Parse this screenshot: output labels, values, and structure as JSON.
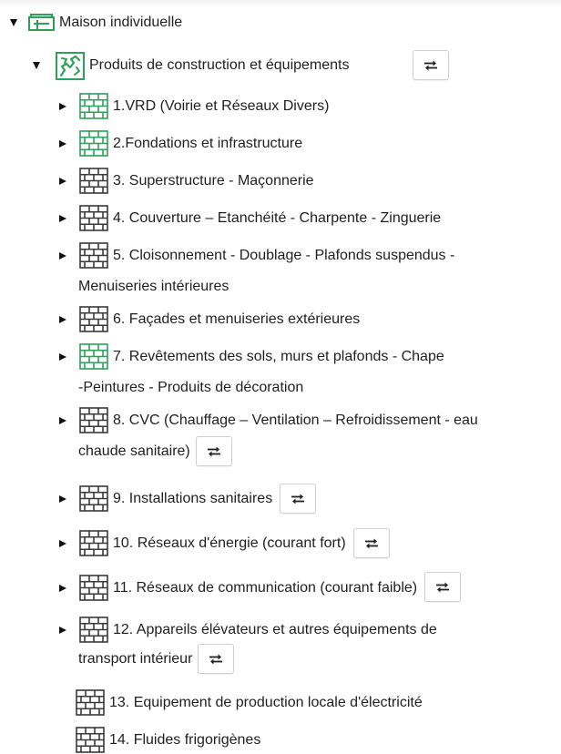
{
  "tree": {
    "root": {
      "label": "Maison individuelle",
      "icon": "building-outline-icon",
      "expanded": true
    },
    "section": {
      "label": "Produits de construction et équipements",
      "icon": "puzzle-icon",
      "expanded": true,
      "action_icon": "swap-arrows-icon"
    },
    "items": [
      {
        "label": "1.VRD (Voirie et Réseaux Divers)",
        "icon": "brick-wall-icon",
        "icon_color": "green",
        "expandable": true
      },
      {
        "label": "2.Fondations et infrastructure",
        "icon": "brick-wall-icon",
        "icon_color": "green",
        "expandable": true
      },
      {
        "label": "3. Superstructure - Maçonnerie",
        "icon": "brick-wall-icon",
        "icon_color": "gray",
        "expandable": true
      },
      {
        "label": "4. Couverture – Etanchéité - Charpente - Zinguerie",
        "icon": "brick-wall-icon",
        "icon_color": "gray",
        "expandable": true
      },
      {
        "label": "5. Cloisonnement - Doublage - Plafonds suspendus -",
        "label_cont": "Menuiseries intérieures",
        "icon": "brick-wall-icon",
        "icon_color": "gray",
        "expandable": true
      },
      {
        "label": "6. Façades et menuiseries extérieures",
        "icon": "brick-wall-icon",
        "icon_color": "gray",
        "expandable": true
      },
      {
        "label": "7. Revêtements des sols, murs et plafonds - Chape",
        "label_cont": "-Peintures - Produits de décoration",
        "icon": "brick-wall-icon",
        "icon_color": "green",
        "expandable": true
      },
      {
        "label": "8. CVC (Chauffage – Ventilation – Refroidissement - eau",
        "label_cont": "chaude sanitaire)",
        "icon": "brick-wall-icon",
        "icon_color": "gray",
        "expandable": true,
        "has_action": true
      },
      {
        "label": "9. Installations sanitaires",
        "icon": "brick-wall-icon",
        "icon_color": "gray",
        "expandable": true,
        "has_action": true
      },
      {
        "label": "10. Réseaux d'énergie (courant fort)",
        "icon": "brick-wall-icon",
        "icon_color": "gray",
        "expandable": true,
        "has_action": true
      },
      {
        "label": "11. Réseaux de communication (courant faible)",
        "icon": "brick-wall-icon",
        "icon_color": "gray",
        "expandable": true,
        "has_action": true
      },
      {
        "label": "12. Appareils élévateurs et autres équipements de",
        "label_cont": "transport intérieur",
        "icon": "brick-wall-icon",
        "icon_color": "gray",
        "expandable": true,
        "has_action": true
      },
      {
        "label": "13. Equipement de production locale d'électricité",
        "icon": "brick-wall-icon",
        "icon_color": "gray",
        "expandable": false
      },
      {
        "label": "14. Fluides frigorigènes",
        "icon": "brick-wall-icon",
        "icon_color": "gray",
        "expandable": false
      }
    ]
  },
  "colors": {
    "green": "#2ea05a",
    "gray": "#3a3a3a",
    "text": "#1f1f1f"
  }
}
